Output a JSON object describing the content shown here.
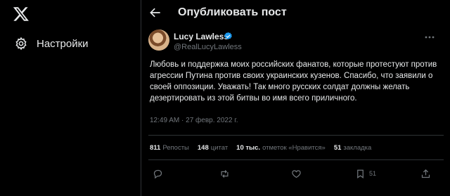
{
  "sidebar": {
    "logo_icon": "x-logo-icon",
    "items": [
      {
        "label": "Настройки",
        "icon": "gear-icon"
      }
    ]
  },
  "header": {
    "title": "Опубликовать пост",
    "back_icon": "arrow-left-icon"
  },
  "tweet": {
    "author_name": "Lucy Lawless",
    "author_handle": "@RealLucyLawless",
    "verified_color": "#1d9bf0",
    "text": "Любовь и поддержка моих российских фанатов, которые протестуют против агрессии Путина против своих украинских кузенов. Спасибо, что заявили о своей оппозиции. Уважать! Так много русских солдат должны желать дезертировать из этой битвы во имя всего приличного.",
    "timestamp": "12:49 AM · 27 февр. 2022 г.",
    "stats": [
      {
        "value": "811",
        "label": "Репосты"
      },
      {
        "value": "148",
        "label": "цитат"
      },
      {
        "value": "10 тыс.",
        "label": "отметок «Нравится»"
      },
      {
        "value": "51",
        "label": "закладка"
      }
    ],
    "actions": {
      "reply_icon": "reply-icon",
      "repost_icon": "repost-icon",
      "like_icon": "heart-icon",
      "bookmark_icon": "bookmark-icon",
      "bookmark_count": "51",
      "share_icon": "share-icon"
    }
  },
  "colors": {
    "background": "#000000",
    "text": "#e7e9ea",
    "muted": "#71767b",
    "border": "#2f3336",
    "accent": "#1d9bf0"
  }
}
